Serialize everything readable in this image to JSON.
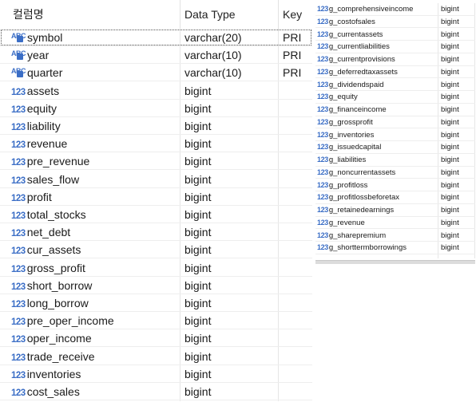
{
  "left_table": {
    "headers": {
      "name": "컬럼명",
      "type": "Data Type",
      "key": "Key"
    },
    "rows": [
      {
        "icon": "ABC",
        "name": "symbol",
        "type": "varchar(20)",
        "key": "PRI"
      },
      {
        "icon": "ABC",
        "name": "year",
        "type": "varchar(10)",
        "key": "PRI"
      },
      {
        "icon": "ABC",
        "name": "quarter",
        "type": "varchar(10)",
        "key": "PRI"
      },
      {
        "icon": "123",
        "name": "assets",
        "type": "bigint",
        "key": ""
      },
      {
        "icon": "123",
        "name": "equity",
        "type": "bigint",
        "key": ""
      },
      {
        "icon": "123",
        "name": "liability",
        "type": "bigint",
        "key": ""
      },
      {
        "icon": "123",
        "name": "revenue",
        "type": "bigint",
        "key": ""
      },
      {
        "icon": "123",
        "name": "pre_revenue",
        "type": "bigint",
        "key": ""
      },
      {
        "icon": "123",
        "name": "sales_flow",
        "type": "bigint",
        "key": ""
      },
      {
        "icon": "123",
        "name": "profit",
        "type": "bigint",
        "key": ""
      },
      {
        "icon": "123",
        "name": "total_stocks",
        "type": "bigint",
        "key": ""
      },
      {
        "icon": "123",
        "name": "net_debt",
        "type": "bigint",
        "key": ""
      },
      {
        "icon": "123",
        "name": "cur_assets",
        "type": "bigint",
        "key": ""
      },
      {
        "icon": "123",
        "name": "gross_profit",
        "type": "bigint",
        "key": ""
      },
      {
        "icon": "123",
        "name": "short_borrow",
        "type": "bigint",
        "key": ""
      },
      {
        "icon": "123",
        "name": "long_borrow",
        "type": "bigint",
        "key": ""
      },
      {
        "icon": "123",
        "name": "pre_oper_income",
        "type": "bigint",
        "key": ""
      },
      {
        "icon": "123",
        "name": "oper_income",
        "type": "bigint",
        "key": ""
      },
      {
        "icon": "123",
        "name": "trade_receive",
        "type": "bigint",
        "key": ""
      },
      {
        "icon": "123",
        "name": "inventories",
        "type": "bigint",
        "key": ""
      },
      {
        "icon": "123",
        "name": "cost_sales",
        "type": "bigint",
        "key": ""
      }
    ]
  },
  "right_table": {
    "rows": [
      {
        "icon": "123",
        "name": "g_comprehensiveincome",
        "type": "bigint"
      },
      {
        "icon": "123",
        "name": "g_costofsales",
        "type": "bigint"
      },
      {
        "icon": "123",
        "name": "g_currentassets",
        "type": "bigint"
      },
      {
        "icon": "123",
        "name": "g_currentliabilities",
        "type": "bigint"
      },
      {
        "icon": "123",
        "name": "g_currentprovisions",
        "type": "bigint"
      },
      {
        "icon": "123",
        "name": "g_deferredtaxassets",
        "type": "bigint"
      },
      {
        "icon": "123",
        "name": "g_dividendspaid",
        "type": "bigint"
      },
      {
        "icon": "123",
        "name": "g_equity",
        "type": "bigint"
      },
      {
        "icon": "123",
        "name": "g_financeincome",
        "type": "bigint"
      },
      {
        "icon": "123",
        "name": "g_grossprofit",
        "type": "bigint"
      },
      {
        "icon": "123",
        "name": "g_inventories",
        "type": "bigint"
      },
      {
        "icon": "123",
        "name": "g_issuedcapital",
        "type": "bigint"
      },
      {
        "icon": "123",
        "name": "g_liabilities",
        "type": "bigint"
      },
      {
        "icon": "123",
        "name": "g_noncurrentassets",
        "type": "bigint"
      },
      {
        "icon": "123",
        "name": "g_profitloss",
        "type": "bigint"
      },
      {
        "icon": "123",
        "name": "g_profitlossbeforetax",
        "type": "bigint"
      },
      {
        "icon": "123",
        "name": "g_retainedearnings",
        "type": "bigint"
      },
      {
        "icon": "123",
        "name": "g_revenue",
        "type": "bigint"
      },
      {
        "icon": "123",
        "name": "g_sharepremium",
        "type": "bigint"
      },
      {
        "icon": "123",
        "name": "g_shorttermborrowings",
        "type": "bigint"
      }
    ]
  },
  "colors": {
    "icon": "#3b6ec6",
    "gridline": "#eeeeee"
  }
}
